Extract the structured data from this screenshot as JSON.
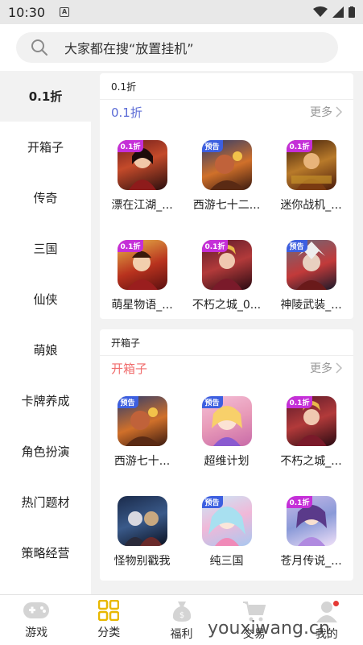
{
  "status_bar": {
    "time": "10:30"
  },
  "search": {
    "placeholder": "大家都在搜“放置挂机”"
  },
  "sidebar": {
    "items": [
      {
        "label": "0.1折"
      },
      {
        "label": "开箱子"
      },
      {
        "label": "传奇"
      },
      {
        "label": "三国"
      },
      {
        "label": "仙侠"
      },
      {
        "label": "萌娘"
      },
      {
        "label": "卡牌养成"
      },
      {
        "label": "角色扮演"
      },
      {
        "label": "热门题材"
      },
      {
        "label": "策略经营"
      }
    ]
  },
  "sections": [
    {
      "top_label": "0.1折",
      "title": "0.1折",
      "title_color": "#5b6bd6",
      "more": "更多",
      "games": [
        {
          "name": "漂在江湖_...",
          "badge": "0.1折",
          "badge_color": "#c52fd8"
        },
        {
          "name": "西游七十二...",
          "badge": "预告",
          "badge_color": "#3d5fe0"
        },
        {
          "name": "迷你战机_...",
          "badge": "0.1折",
          "badge_color": "#c52fd8"
        },
        {
          "name": "萌星物语_...",
          "badge": "0.1折",
          "badge_color": "#c52fd8"
        },
        {
          "name": "不朽之城_0...",
          "badge": "0.1折",
          "badge_color": "#c52fd8"
        },
        {
          "name": "神陵武装_...",
          "badge": "预告",
          "badge_color": "#3d5fe0"
        }
      ]
    },
    {
      "top_label": "开箱子",
      "title": "开箱子",
      "title_color": "#f06c6c",
      "more": "更多",
      "games": [
        {
          "name": "西游七十...",
          "badge": "预告",
          "badge_color": "#3d5fe0"
        },
        {
          "name": "超维计划",
          "badge": "预告",
          "badge_color": "#3d5fe0"
        },
        {
          "name": "不朽之城_...",
          "badge": "0.1折",
          "badge_color": "#c52fd8"
        },
        {
          "name": "怪物别戳我",
          "badge": "",
          "badge_color": ""
        },
        {
          "name": "纯三国",
          "badge": "预告",
          "badge_color": "#3d5fe0"
        },
        {
          "name": "苍月传说_...",
          "badge": "0.1折",
          "badge_color": "#c52fd8"
        }
      ]
    }
  ],
  "tabbar": {
    "items": [
      {
        "label": "游戏",
        "icon": "gamepad-icon"
      },
      {
        "label": "分类",
        "icon": "grid-icon"
      },
      {
        "label": "福利",
        "icon": "money-bag-icon"
      },
      {
        "label": "交易",
        "icon": "cart-icon"
      },
      {
        "label": "我的",
        "icon": "user-icon"
      }
    ]
  },
  "watermark": "youxiwang.cn"
}
